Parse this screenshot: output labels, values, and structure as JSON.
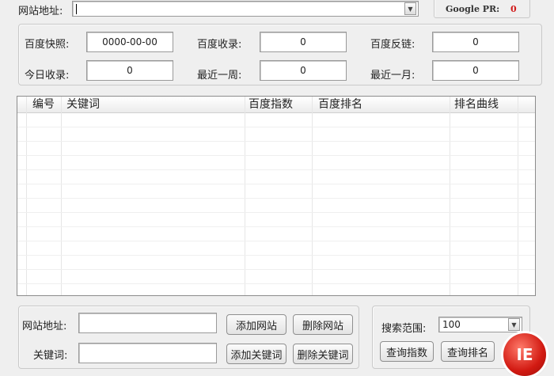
{
  "top": {
    "url_label": "网站地址:",
    "url_value": "",
    "pr_label": "Google PR:",
    "pr_value": "0"
  },
  "stats": [
    {
      "label": "百度快照:",
      "value": "0000-00-00"
    },
    {
      "label": "百度收录:",
      "value": "0"
    },
    {
      "label": "百度反链:",
      "value": "0"
    },
    {
      "label": "今日收录:",
      "value": "0"
    },
    {
      "label": "最近一周:",
      "value": "0"
    },
    {
      "label": "最近一月:",
      "value": "0"
    }
  ],
  "table": {
    "columns": [
      "编号",
      "关键词",
      "百度指数",
      "百度排名",
      "排名曲线"
    ]
  },
  "bottom": {
    "site_label": "网站地址:",
    "site_value": "",
    "keyword_label": "关键词:",
    "keyword_value": "",
    "add_site": "添加网站",
    "delete_site": "删除网站",
    "add_keyword": "添加关键词",
    "delete_keyword": "删除关键词",
    "range_label": "搜索范围:",
    "range_value": "100",
    "query_index": "查询指数",
    "query_rank": "查询排名"
  },
  "badge": {
    "text": "IE"
  },
  "colors": {
    "pr_value": "#d11a1a",
    "badge": "#d21a12"
  }
}
